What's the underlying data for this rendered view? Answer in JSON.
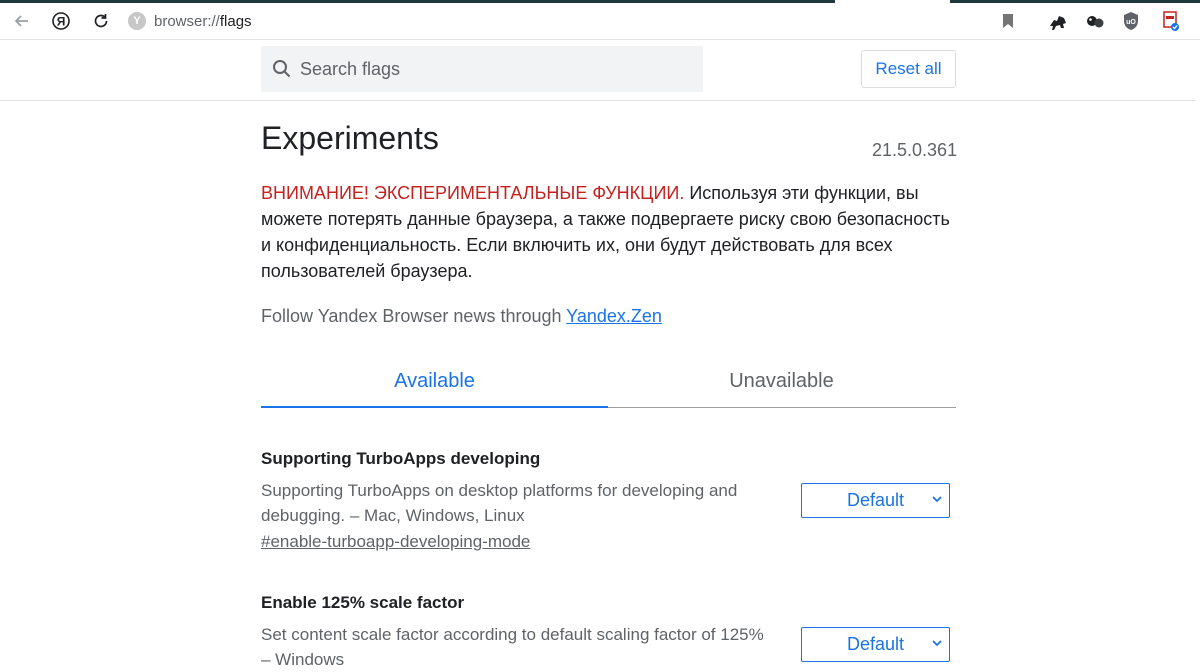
{
  "browser": {
    "url_scheme": "browser://",
    "url_path": "flags",
    "site_badge": "Y",
    "back_icon": "arrow-left-icon",
    "yandex_icon": "yandex-logo-icon",
    "reload_icon": "reload-icon",
    "bookmark_icon": "bookmark-icon",
    "extensions": [
      "horse-extension-icon",
      "bubbles-extension-icon",
      "ublock-shield-icon",
      "pdf-extension-icon"
    ]
  },
  "header": {
    "search_placeholder": "Search flags",
    "reset_label": "Reset all"
  },
  "page": {
    "title": "Experiments",
    "version": "21.5.0.361",
    "warning_red": "ВНИМАНИЕ! ЭКСПЕРИМЕНТАЛЬНЫЕ ФУНКЦИИ.",
    "warning_text": " Используя эти функции, вы можете потерять данные браузера, а также подвергаете риску свою безопасность и конфиденциальность. Если включить их, они будут действовать для всех пользователей браузера.",
    "follow_text": "Follow Yandex Browser news through ",
    "follow_link": "Yandex.Zen"
  },
  "tabs": {
    "available": "Available",
    "unavailable": "Unavailable"
  },
  "flags": [
    {
      "name": "Supporting TurboApps developing",
      "description": "Supporting TurboApps on desktop platforms for developing and debugging. – Mac, Windows, Linux",
      "anchor": "#enable-turboapp-developing-mode",
      "value": "Default"
    },
    {
      "name": "Enable 125% scale factor",
      "description": "Set content scale factor according to default scaling factor of 125% – Windows",
      "anchor": "",
      "value": "Default"
    }
  ],
  "colors": {
    "accent": "#1a73e8",
    "warning": "#c5221f",
    "text_secondary": "#5f6368"
  }
}
